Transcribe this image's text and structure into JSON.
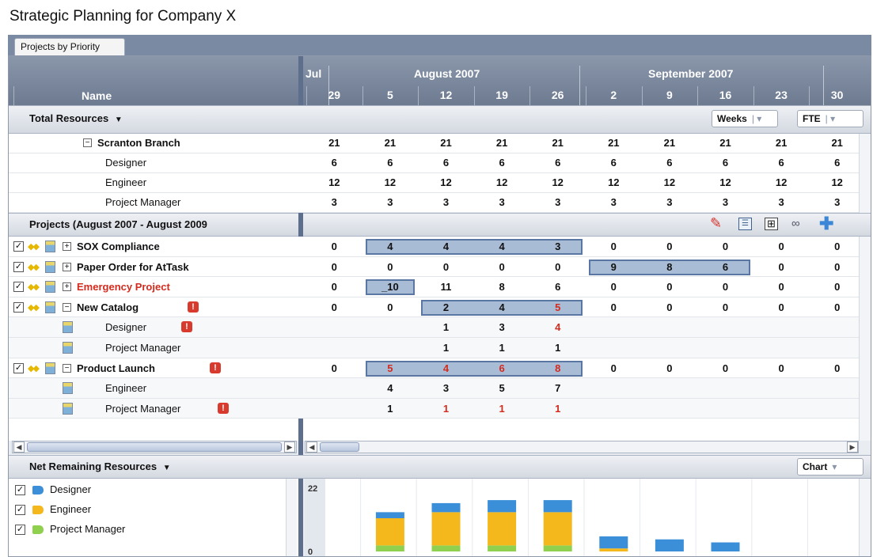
{
  "app": {
    "title": "Strategic Planning for Company X"
  },
  "tabs": [
    {
      "label": "Projects by Priority"
    }
  ],
  "timeline": {
    "name_header": "Name",
    "months": [
      {
        "label": "Jul"
      },
      {
        "label": "August 2007"
      },
      {
        "label": "September 2007"
      }
    ],
    "weeks": [
      "29",
      "5",
      "12",
      "19",
      "26",
      "2",
      "9",
      "16",
      "23",
      "30"
    ]
  },
  "total_resources": {
    "title": "Total Resources",
    "weeks_select": "Weeks",
    "fte_select": "FTE",
    "group": {
      "label": "Scranton Branch",
      "values": [
        "21",
        "21",
        "21",
        "21",
        "21",
        "21",
        "21",
        "21",
        "21",
        "21"
      ]
    },
    "roles": [
      {
        "label": "Designer",
        "values": [
          "6",
          "6",
          "6",
          "6",
          "6",
          "6",
          "6",
          "6",
          "6",
          "6"
        ]
      },
      {
        "label": "Engineer",
        "values": [
          "12",
          "12",
          "12",
          "12",
          "12",
          "12",
          "12",
          "12",
          "12",
          "12"
        ]
      },
      {
        "label": "Project Manager",
        "values": [
          "3",
          "3",
          "3",
          "3",
          "3",
          "3",
          "3",
          "3",
          "3",
          "3"
        ]
      }
    ]
  },
  "projects": {
    "title": "Projects (August 2007 - August 2009",
    "rows": [
      {
        "label": "SOX Compliance",
        "values": [
          "0",
          "4",
          "4",
          "4",
          "3",
          "0",
          "0",
          "0",
          "0",
          "0"
        ],
        "hl": [
          1,
          4
        ],
        "red": []
      },
      {
        "label": "Paper Order for AtTask",
        "values": [
          "0",
          "0",
          "0",
          "0",
          "0",
          "9",
          "8",
          "6",
          "0",
          "0"
        ],
        "hl": [
          5,
          7
        ],
        "red": []
      },
      {
        "label": "Emergency Project",
        "label_red": true,
        "values": [
          "0",
          "_10",
          "11",
          "8",
          "6",
          "0",
          "0",
          "0",
          "0",
          "0"
        ],
        "hl": [
          1,
          1
        ],
        "red": []
      },
      {
        "label": "New Catalog",
        "warn": true,
        "values": [
          "0",
          "0",
          "2",
          "4",
          "5",
          "0",
          "0",
          "0",
          "0",
          "0"
        ],
        "hl": [
          2,
          4
        ],
        "red": [
          4
        ]
      },
      {
        "label": "Designer",
        "sub": true,
        "warn": true,
        "values": [
          "",
          "",
          "1",
          "3",
          "4",
          "",
          "",
          "",
          "",
          ""
        ],
        "red": [
          4
        ]
      },
      {
        "label": "Project Manager",
        "sub": true,
        "values": [
          "",
          "",
          "1",
          "1",
          "1",
          "",
          "",
          "",
          "",
          ""
        ],
        "red": []
      },
      {
        "label": "Product Launch",
        "warn": true,
        "values": [
          "0",
          "5",
          "4",
          "6",
          "8",
          "0",
          "0",
          "0",
          "0",
          "0"
        ],
        "hl": [
          1,
          4
        ],
        "red": [
          1,
          2,
          3,
          4
        ]
      },
      {
        "label": "Engineer",
        "sub": true,
        "values": [
          "",
          "4",
          "3",
          "5",
          "7",
          "",
          "",
          "",
          "",
          ""
        ],
        "red": []
      },
      {
        "label": "Project Manager",
        "sub": true,
        "warn": true,
        "values": [
          "",
          "1",
          "1",
          "1",
          "1",
          "",
          "",
          "",
          "",
          ""
        ],
        "red": [
          2,
          3,
          4
        ]
      }
    ]
  },
  "net_remaining": {
    "title": "Net Remaining Resources",
    "view_select": "Chart",
    "legend": [
      {
        "label": "Designer",
        "color": "#3a8fd8"
      },
      {
        "label": "Engineer",
        "color": "#f4b81c"
      },
      {
        "label": "Project Manager",
        "color": "#8fd14f"
      }
    ]
  },
  "chart_data": {
    "type": "bar",
    "stacked": true,
    "categories": [
      "29",
      "5",
      "12",
      "19",
      "26",
      "2",
      "9",
      "16",
      "23",
      "30"
    ],
    "y_tick_labels": [
      "22",
      "0"
    ],
    "ylim": [
      0,
      22
    ],
    "series": [
      {
        "name": "Designer",
        "values": [
          null,
          2,
          3,
          4,
          4,
          4,
          4,
          3,
          null,
          null
        ],
        "color": "#3a8fd8"
      },
      {
        "name": "Engineer",
        "values": [
          null,
          9,
          11,
          11,
          11,
          1,
          0,
          0,
          null,
          null
        ],
        "color": "#f4b81c"
      },
      {
        "name": "Project Manager",
        "values": [
          null,
          2,
          2,
          2,
          2,
          0,
          0,
          0,
          null,
          null
        ],
        "color": "#8fd14f"
      }
    ]
  }
}
